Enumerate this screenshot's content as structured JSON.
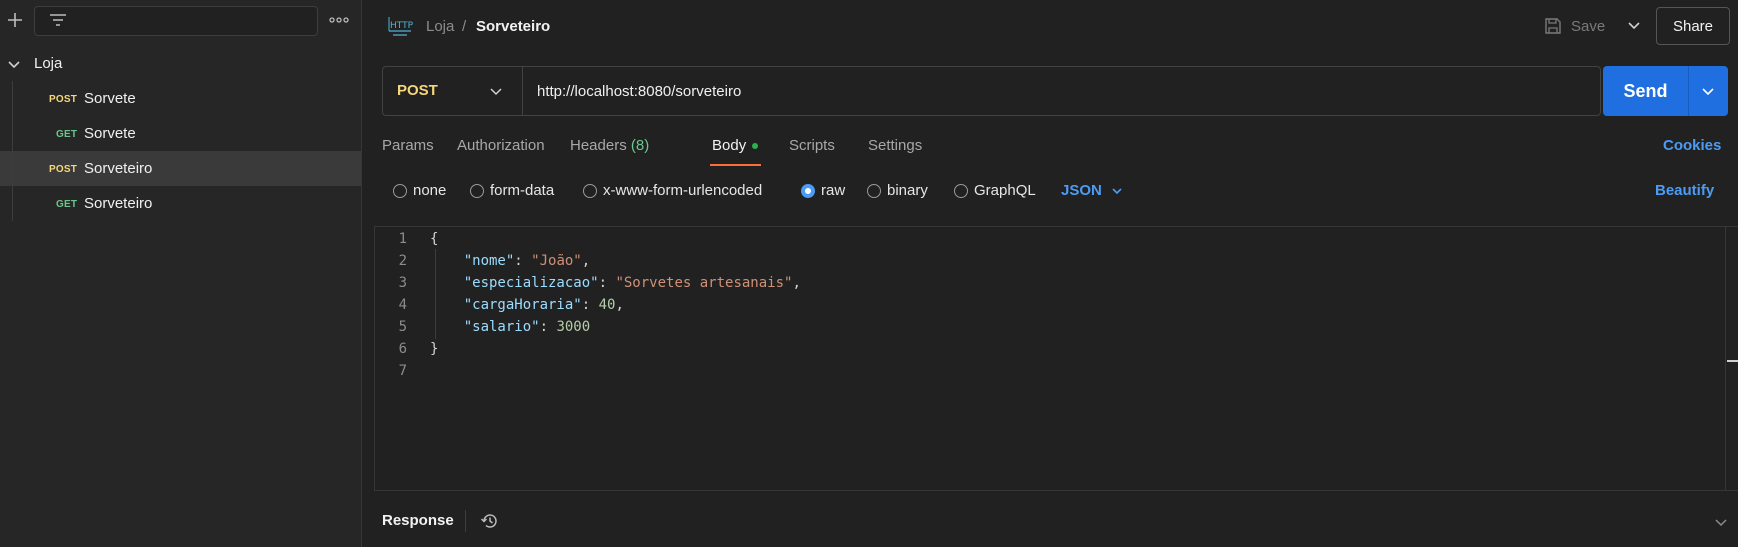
{
  "sidebar": {
    "collection": "Loja",
    "requests": [
      {
        "method": "POST",
        "name": "Sorvete"
      },
      {
        "method": "GET",
        "name": "Sorvete"
      },
      {
        "method": "POST",
        "name": "Sorveteiro"
      },
      {
        "method": "GET",
        "name": "Sorveteiro"
      }
    ]
  },
  "header": {
    "breadcrumb_parent": "Loja",
    "breadcrumb_separator": "/",
    "breadcrumb_current": "Sorveteiro",
    "save_label": "Save",
    "share_label": "Share"
  },
  "request": {
    "method": "POST",
    "url": "http://localhost:8080/sorveteiro",
    "send_label": "Send"
  },
  "tabs": {
    "params": "Params",
    "authorization": "Authorization",
    "headers": "Headers",
    "headers_count": "(8)",
    "body": "Body",
    "scripts": "Scripts",
    "settings": "Settings",
    "cookies": "Cookies"
  },
  "body_options": {
    "none": "none",
    "form_data": "form-data",
    "urlencoded": "x-www-form-urlencoded",
    "raw": "raw",
    "binary": "binary",
    "graphql": "GraphQL",
    "selected": "raw",
    "language": "JSON",
    "beautify": "Beautify"
  },
  "editor": {
    "line_numbers": [
      "1",
      "2",
      "3",
      "4",
      "5",
      "6",
      "7"
    ],
    "lines": {
      "l1": "{",
      "l2_key": "\"nome\"",
      "l2_val": "\"João\"",
      "l3_key": "\"especializacao\"",
      "l3_val": "\"Sorvetes artesanais\"",
      "l4_key": "\"cargaHoraria\"",
      "l4_val": "40",
      "l5_key": "\"salario\"",
      "l5_val": "3000",
      "l6": "}"
    }
  },
  "response": {
    "label": "Response"
  },
  "colors": {
    "post": "#f6d67a",
    "get": "#6bc68e",
    "accent": "#1f6fe0",
    "link": "#4b9cf5",
    "tab_indicator": "#ff6c37"
  }
}
